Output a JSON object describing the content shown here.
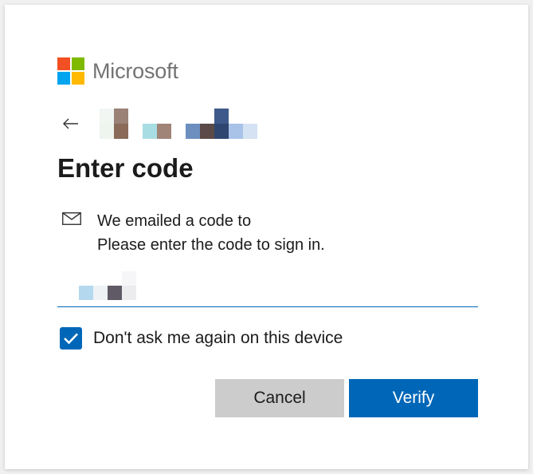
{
  "brand": {
    "wordmark": "Microsoft",
    "logo_colors": [
      "#f25022",
      "#7fba00",
      "#00a4ef",
      "#ffb900"
    ]
  },
  "header": {
    "back_icon": "arrow-left-icon"
  },
  "main": {
    "title": "Enter code",
    "mail_icon": "envelope-icon",
    "emailed_text": "We emailed a code to",
    "instruction_text": "Please enter the code to sign in.",
    "code_field_value": ""
  },
  "options": {
    "dont_ask_label": "Don't ask me again on this device",
    "dont_ask_checked": true
  },
  "actions": {
    "cancel_label": "Cancel",
    "verify_label": "Verify"
  },
  "colors": {
    "accent": "#0067b8",
    "cancel_bg": "#cccccc",
    "text": "#1b1b1b",
    "wordmark": "#737373"
  }
}
